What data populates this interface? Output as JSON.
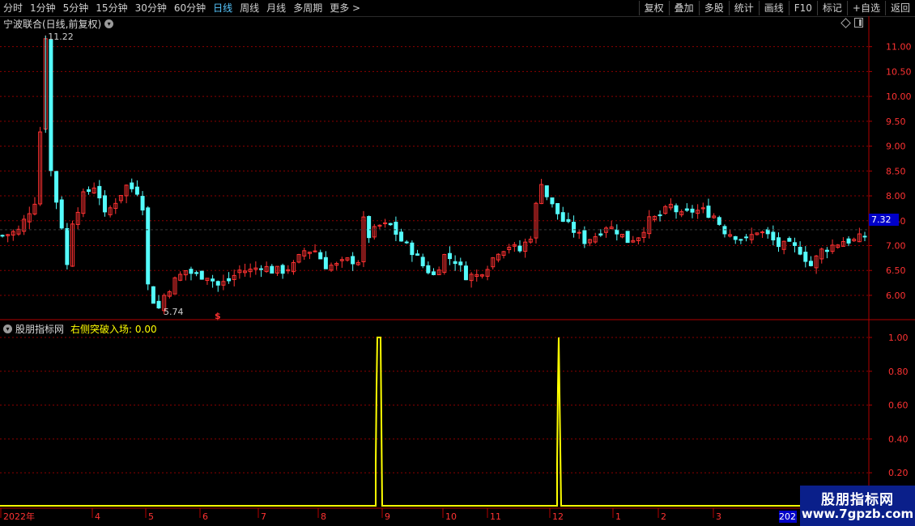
{
  "toolbar": {
    "periods": [
      "分时",
      "1分钟",
      "5分钟",
      "15分钟",
      "30分钟",
      "60分钟",
      "日线",
      "周线",
      "月线",
      "多周期",
      "更多 >"
    ],
    "active_period": "日线",
    "buttons": [
      "复权",
      "叠加",
      "多股",
      "统计",
      "画线",
      "F10",
      "标记",
      "+自选",
      "返回"
    ]
  },
  "stock": {
    "title": "宁波联合(日线,前复权)",
    "last_price": "7.32",
    "high_label": "11.22",
    "low_label": "5.74"
  },
  "indicator": {
    "name": "股朋指标网",
    "value_label": "右侧突破入场: 0.00"
  },
  "date_box": "2023",
  "watermark": {
    "line1": "股朋指标网",
    "line2": "www.7gpzb.com"
  },
  "colors": {
    "up": "#ff3232",
    "down": "#54fcfc",
    "indicator": "#ffff00",
    "grid": "#8b0000",
    "axis": "#b00000",
    "price_tag": "#0000c8"
  },
  "chart_data": [
    {
      "type": "candlestick",
      "title": "宁波联合(日线,前复权)",
      "price_axis_ticks": [
        "11.00",
        "10.50",
        "10.00",
        "9.50",
        "9.00",
        "8.50",
        "8.00",
        "7.50",
        "7.00",
        "6.50",
        "6.00"
      ],
      "ylim": [
        5.5,
        11.5
      ],
      "x_ticks": [
        "2022年",
        "4",
        "5",
        "6",
        "7",
        "8",
        "9",
        "10",
        "11",
        "12",
        "1",
        "2",
        "3"
      ],
      "annotations": [
        {
          "text": "11.22",
          "type": "high"
        },
        {
          "text": "5.74",
          "type": "low"
        },
        {
          "text": "$",
          "type": "marker",
          "color": "#ff3232"
        }
      ],
      "last_price": 7.32,
      "close_path": [
        [
          0,
          7.2
        ],
        [
          3,
          7.3
        ],
        [
          6,
          7.9
        ],
        [
          7,
          9.3
        ],
        [
          8,
          11.22
        ],
        [
          9,
          8.5
        ],
        [
          10,
          7.9
        ],
        [
          11,
          7.4
        ],
        [
          12,
          6.6
        ],
        [
          13,
          7.5
        ],
        [
          15,
          8.0
        ],
        [
          17,
          8.2
        ],
        [
          18,
          8.0
        ],
        [
          19,
          7.6
        ],
        [
          21,
          7.9
        ],
        [
          23,
          8.2
        ],
        [
          25,
          8.1
        ],
        [
          26,
          7.8
        ],
        [
          27,
          6.2
        ],
        [
          28,
          5.9
        ],
        [
          29,
          5.74
        ],
        [
          30,
          6.0
        ],
        [
          32,
          6.3
        ],
        [
          34,
          6.5
        ],
        [
          36,
          6.4
        ],
        [
          38,
          6.4
        ],
        [
          40,
          6.2
        ],
        [
          42,
          6.3
        ],
        [
          44,
          6.5
        ],
        [
          46,
          6.5
        ],
        [
          48,
          6.6
        ],
        [
          50,
          6.5
        ],
        [
          52,
          6.5
        ],
        [
          54,
          6.6
        ],
        [
          56,
          6.9
        ],
        [
          58,
          6.9
        ],
        [
          60,
          6.6
        ],
        [
          62,
          6.6
        ],
        [
          64,
          6.7
        ],
        [
          66,
          6.7
        ],
        [
          67,
          7.5
        ],
        [
          68,
          7.2
        ],
        [
          70,
          7.4
        ],
        [
          72,
          7.4
        ],
        [
          74,
          7.1
        ],
        [
          76,
          6.9
        ],
        [
          78,
          6.6
        ],
        [
          80,
          6.4
        ],
        [
          82,
          6.8
        ],
        [
          84,
          6.7
        ],
        [
          86,
          6.4
        ],
        [
          88,
          6.4
        ],
        [
          90,
          6.6
        ],
        [
          92,
          6.9
        ],
        [
          94,
          7.0
        ],
        [
          96,
          6.9
        ],
        [
          98,
          7.2
        ],
        [
          99,
          7.8
        ],
        [
          100,
          8.3
        ],
        [
          101,
          8.0
        ],
        [
          102,
          7.8
        ],
        [
          104,
          7.5
        ],
        [
          106,
          7.3
        ],
        [
          108,
          7.1
        ],
        [
          110,
          7.2
        ],
        [
          112,
          7.4
        ],
        [
          114,
          7.3
        ],
        [
          116,
          7.1
        ],
        [
          118,
          7.2
        ],
        [
          120,
          7.5
        ],
        [
          122,
          7.6
        ],
        [
          124,
          7.8
        ],
        [
          126,
          7.6
        ],
        [
          128,
          7.7
        ],
        [
          130,
          7.7
        ],
        [
          132,
          7.6
        ],
        [
          134,
          7.3
        ],
        [
          136,
          7.2
        ],
        [
          138,
          7.1
        ],
        [
          140,
          7.3
        ],
        [
          142,
          7.2
        ],
        [
          144,
          7.0
        ],
        [
          146,
          7.0
        ],
        [
          148,
          6.9
        ],
        [
          150,
          6.6
        ],
        [
          152,
          6.9
        ],
        [
          154,
          7.0
        ],
        [
          156,
          7.1
        ],
        [
          158,
          7.1
        ],
        [
          160,
          7.2
        ]
      ]
    },
    {
      "type": "line",
      "title": "右侧突破入场",
      "y_ticks": [
        "1.00",
        "0.80",
        "0.60",
        "0.40",
        "0.20"
      ],
      "ylim": [
        0,
        1.0
      ],
      "series": [
        {
          "name": "右侧突破入场",
          "value_label": "0.00"
        }
      ],
      "signal_dates": [
        "8月末",
        "12月初"
      ],
      "signal_value": 1.0
    }
  ]
}
